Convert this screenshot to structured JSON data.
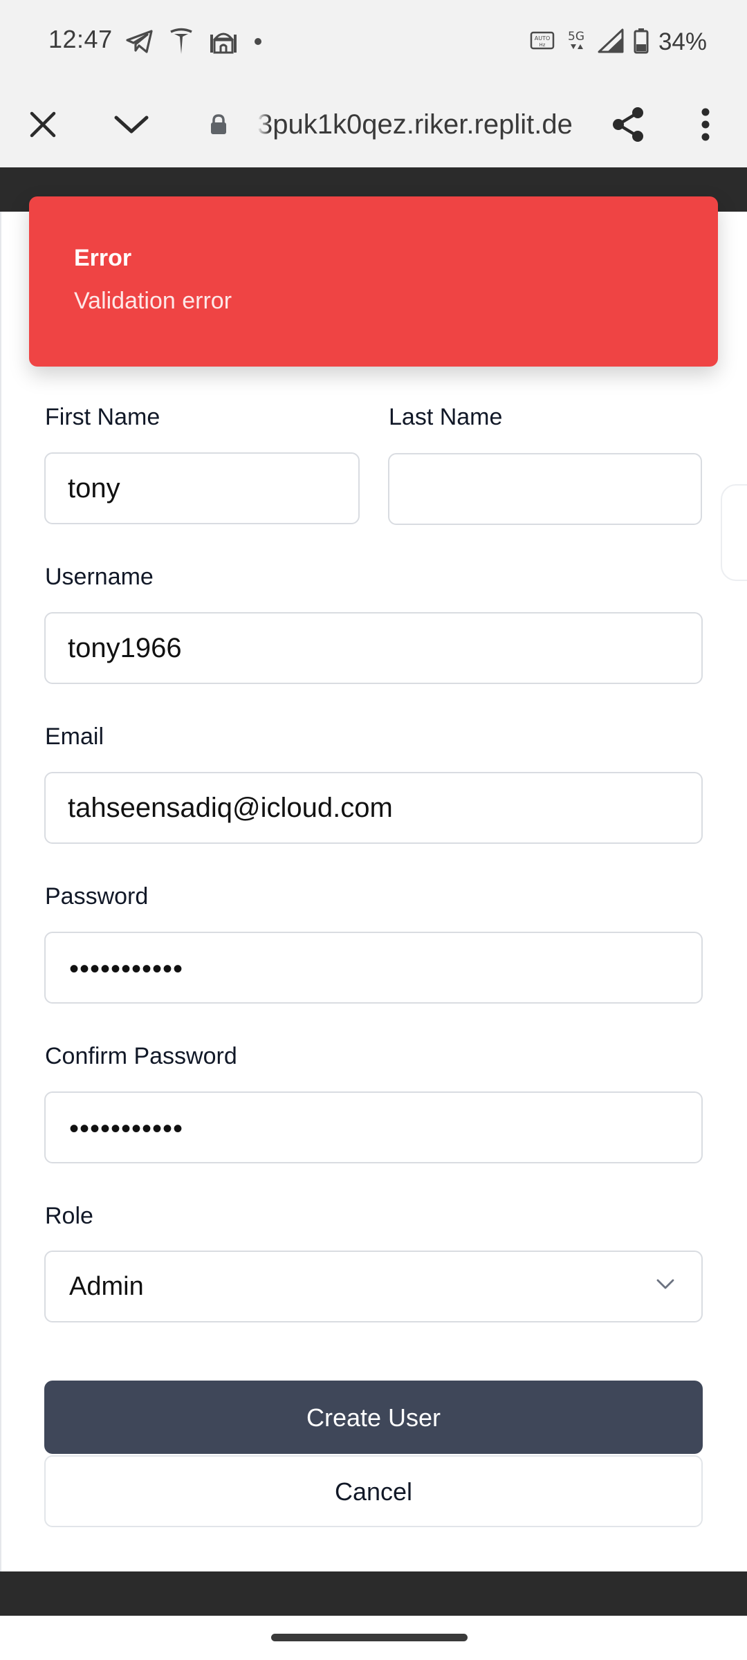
{
  "status_bar": {
    "time": "12:47",
    "battery": "34%",
    "network": "5G",
    "icons_left": [
      "telegram-icon",
      "tesla-icon",
      "mosque-icon",
      "dot-icon"
    ],
    "icons_right": [
      "auto-hz-icon",
      "5g-icon",
      "signal-icon",
      "battery-icon"
    ]
  },
  "browser": {
    "url": "3puk1k0qez.riker.replit.de",
    "icons": [
      "close-icon",
      "chevron-down-icon",
      "lock-icon",
      "share-icon",
      "more-vert-icon"
    ]
  },
  "toast": {
    "title": "Error",
    "message": "Validation error",
    "color": "#ef4444"
  },
  "form": {
    "first_name": {
      "label": "First Name",
      "value": "tony"
    },
    "last_name": {
      "label": "Last Name",
      "value": ""
    },
    "username": {
      "label": "Username",
      "value": "tony1966"
    },
    "email": {
      "label": "Email",
      "value": "tahseensadiq@icloud.com"
    },
    "password": {
      "label": "Password",
      "masked": "•••••••••••"
    },
    "confirm_password": {
      "label": "Confirm Password",
      "masked": "•••••••••••"
    },
    "role": {
      "label": "Role",
      "value": "Admin"
    },
    "create_label": "Create User",
    "cancel_label": "Cancel",
    "primary_color": "#3f4759"
  }
}
